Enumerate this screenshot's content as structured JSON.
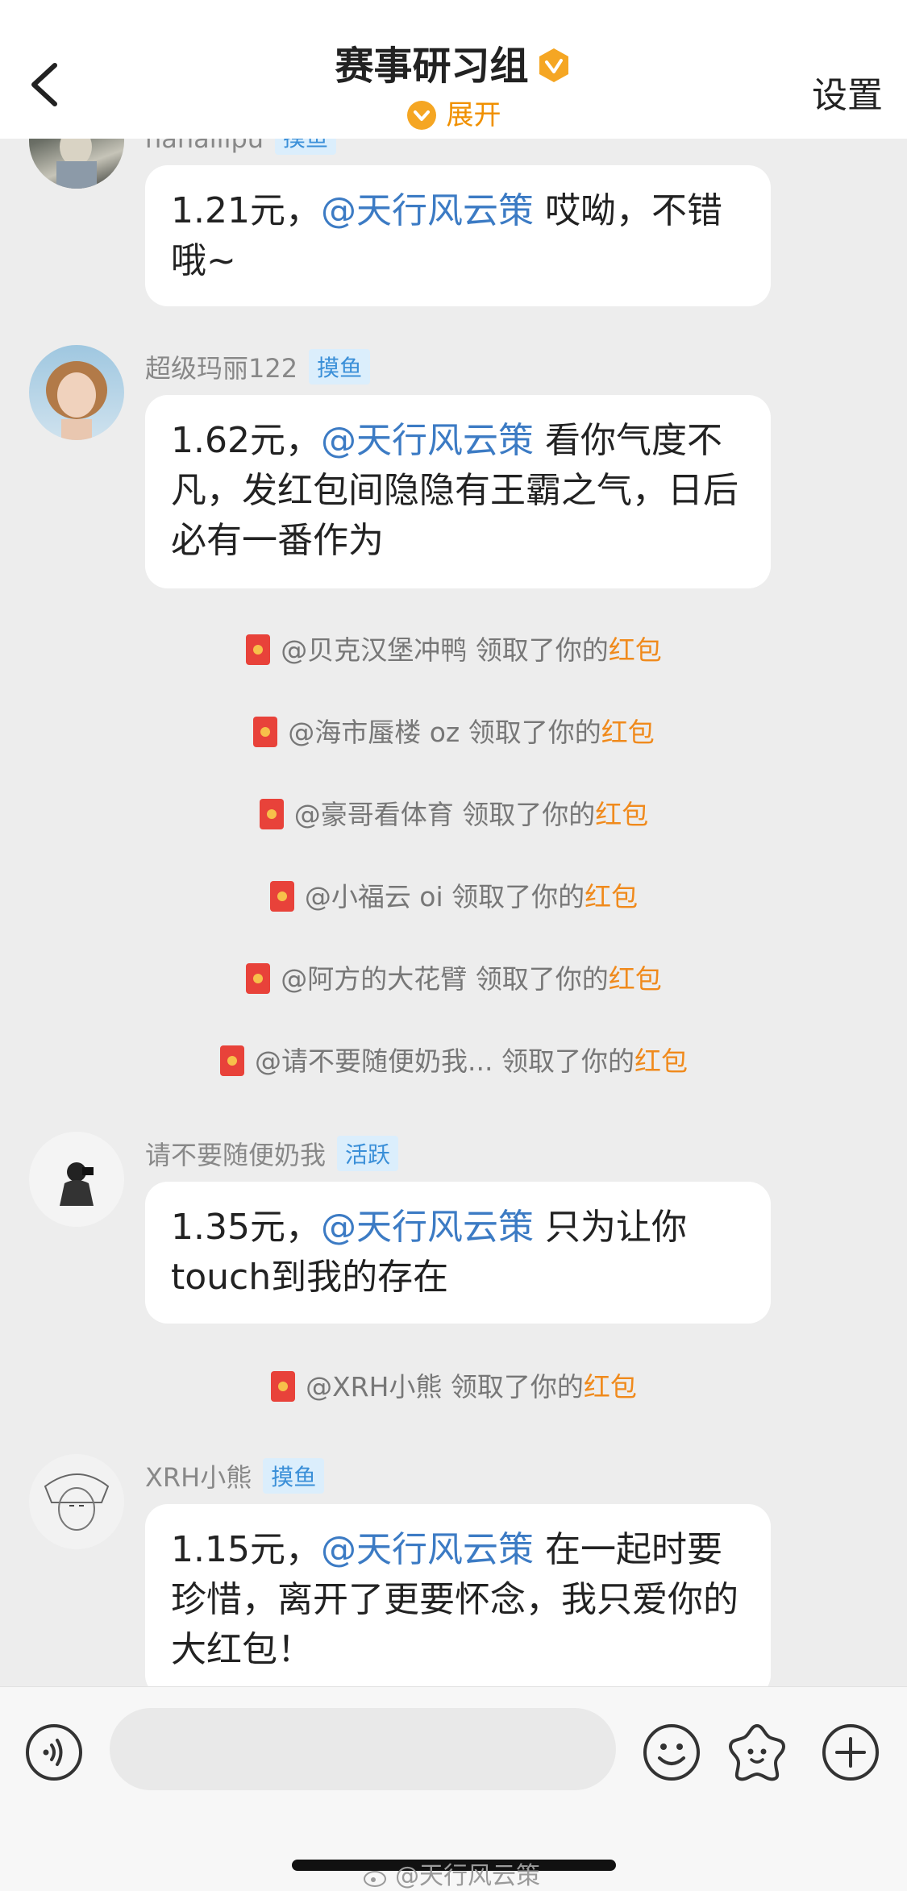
{
  "header": {
    "title": "赛事研习组",
    "expand_label": "展开",
    "settings_label": "设置"
  },
  "messages": [
    {
      "sender": "nanailipu",
      "tag": "摸鱼",
      "amount": "1.21元，",
      "mention": "@天行风云策",
      "text": " 哎呦，不错哦~"
    },
    {
      "sender": "超级玛丽122",
      "tag": "摸鱼",
      "amount": "1.62元，",
      "mention": "@天行风云策",
      "text": " 看你气度不凡，发红包间隐隐有王霸之气，日后必有一番作为"
    },
    {
      "sender": "请不要随便奶我",
      "tag": "活跃",
      "amount": "1.35元，",
      "mention": "@天行风云策",
      "text": " 只为让你touch到我的存在"
    },
    {
      "sender": "XRH小熊",
      "tag": "摸鱼",
      "amount": "1.15元，",
      "mention": "@天行风云策",
      "text": " 在一起时要珍惜，离开了更要怀念，我只爱你的大红包！"
    }
  ],
  "system_notices": [
    {
      "name": "@贝克汉堡冲鸭",
      "action": " 领取了你的",
      "hongbao": "红包"
    },
    {
      "name": "@海市蜃楼 oz",
      "action": " 领取了你的",
      "hongbao": "红包"
    },
    {
      "name": "@豪哥看体育",
      "action": " 领取了你的",
      "hongbao": "红包"
    },
    {
      "name": "@小福云 oi",
      "action": " 领取了你的",
      "hongbao": "红包"
    },
    {
      "name": "@阿方的大花臂",
      "action": " 领取了你的",
      "hongbao": "红包"
    },
    {
      "name": "@请不要随便奶我...",
      "action": " 领取了你的",
      "hongbao": "红包"
    },
    {
      "name": "@XRH小熊",
      "action": " 领取了你的",
      "hongbao": "红包"
    }
  ],
  "watermark": "@天行风云策",
  "colors": {
    "accent_orange": "#f09000",
    "mention_blue": "#3c7bc4",
    "hongbao_red": "#e8423a"
  },
  "icons": [
    "back-icon",
    "verified-badge-icon",
    "chevron-down-icon",
    "red-packet-icon",
    "voice-icon",
    "emoji-icon",
    "sticker-icon",
    "plus-icon"
  ]
}
